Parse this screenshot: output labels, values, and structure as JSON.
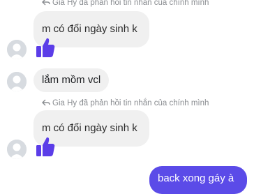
{
  "messages": {
    "reply_note_1": "Gia Hy đã phản hồi tin nhắn của chính mình",
    "quoted_1": "m có đổi ngày sinh k",
    "message_2": "lắm mồm vcl",
    "reply_note_2": "Gia Hy đã phản hồi tin nhắn của chính mình",
    "quoted_2": "m có đổi ngày sinh k",
    "sent_message": "back xong gáy à"
  },
  "colors": {
    "received_bubble": "#f0f0f0",
    "sent_bubble": "#5b4be8",
    "like_icon": "#5b3de8",
    "meta_text": "#8a8d91"
  },
  "icons": [
    "reply-arrow-icon",
    "thumbs-up-icon",
    "avatar-placeholder-icon"
  ]
}
